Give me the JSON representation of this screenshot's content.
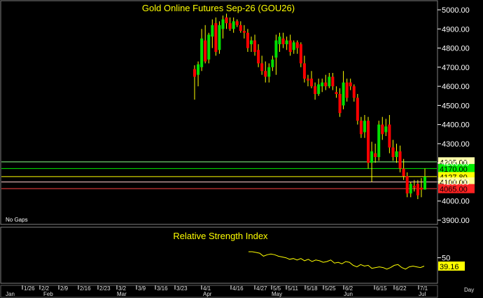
{
  "chart_data": [
    {
      "type": "candlestick",
      "title": "Gold Online Futures Sep-26 (GOU26)",
      "note": "No Gaps",
      "ylim": [
        3880,
        5030
      ],
      "yticks": [
        3900,
        4000,
        4100,
        4200,
        4300,
        4400,
        4500,
        4600,
        4700,
        4800,
        4900,
        5000
      ],
      "ytick_labels": [
        "3900.00",
        "4000.00",
        "4100.00",
        "4200.00",
        "4300.00",
        "4400.00",
        "4500.00",
        "4600.00",
        "4700.00",
        "4800.00",
        "4900.00",
        "5000.00"
      ],
      "colors": {
        "up": "#00e000",
        "down": "#ff0000",
        "wick": "#ffff00",
        "title": "#ffff00"
      },
      "candles": [
        {
          "o": 4690,
          "h": 4710,
          "l": 4530,
          "c": 4650
        },
        {
          "o": 4660,
          "h": 4730,
          "l": 4600,
          "c": 4715
        },
        {
          "o": 4700,
          "h": 4900,
          "l": 4680,
          "c": 4850
        },
        {
          "o": 4840,
          "h": 4920,
          "l": 4720,
          "c": 4730
        },
        {
          "o": 4740,
          "h": 4880,
          "l": 4720,
          "c": 4870
        },
        {
          "o": 4860,
          "h": 4950,
          "l": 4800,
          "c": 4920
        },
        {
          "o": 4930,
          "h": 4960,
          "l": 4760,
          "c": 4780
        },
        {
          "o": 4790,
          "h": 4940,
          "l": 4770,
          "c": 4920
        },
        {
          "o": 4900,
          "h": 4970,
          "l": 4850,
          "c": 4950
        },
        {
          "o": 4960,
          "h": 4980,
          "l": 4900,
          "c": 4930
        },
        {
          "o": 4930,
          "h": 4960,
          "l": 4890,
          "c": 4900
        },
        {
          "o": 4900,
          "h": 4960,
          "l": 4880,
          "c": 4940
        },
        {
          "o": 4940,
          "h": 4950,
          "l": 4910,
          "c": 4920
        },
        {
          "o": 4920,
          "h": 4940,
          "l": 4880,
          "c": 4890
        },
        {
          "o": 4890,
          "h": 4920,
          "l": 4850,
          "c": 4880
        },
        {
          "o": 4880,
          "h": 4900,
          "l": 4780,
          "c": 4800
        },
        {
          "o": 4820,
          "h": 4860,
          "l": 4780,
          "c": 4840
        },
        {
          "o": 4840,
          "h": 4870,
          "l": 4760,
          "c": 4780
        },
        {
          "o": 4790,
          "h": 4820,
          "l": 4700,
          "c": 4720
        },
        {
          "o": 4720,
          "h": 4760,
          "l": 4660,
          "c": 4680
        },
        {
          "o": 4680,
          "h": 4730,
          "l": 4620,
          "c": 4650
        },
        {
          "o": 4650,
          "h": 4720,
          "l": 4620,
          "c": 4700
        },
        {
          "o": 4700,
          "h": 4760,
          "l": 4680,
          "c": 4740
        },
        {
          "o": 4750,
          "h": 4870,
          "l": 4660,
          "c": 4840
        },
        {
          "o": 4820,
          "h": 4880,
          "l": 4780,
          "c": 4860
        },
        {
          "o": 4850,
          "h": 4880,
          "l": 4800,
          "c": 4820
        },
        {
          "o": 4820,
          "h": 4860,
          "l": 4790,
          "c": 4840
        },
        {
          "o": 4840,
          "h": 4870,
          "l": 4760,
          "c": 4780
        },
        {
          "o": 4790,
          "h": 4840,
          "l": 4770,
          "c": 4830
        },
        {
          "o": 4830,
          "h": 4840,
          "l": 4770,
          "c": 4800
        },
        {
          "o": 4820,
          "h": 4830,
          "l": 4700,
          "c": 4720
        },
        {
          "o": 4720,
          "h": 4760,
          "l": 4620,
          "c": 4640
        },
        {
          "o": 4640,
          "h": 4660,
          "l": 4600,
          "c": 4630
        },
        {
          "o": 4640,
          "h": 4680,
          "l": 4590,
          "c": 4600
        },
        {
          "o": 4600,
          "h": 4620,
          "l": 4530,
          "c": 4560
        },
        {
          "o": 4560,
          "h": 4640,
          "l": 4550,
          "c": 4610
        },
        {
          "o": 4600,
          "h": 4640,
          "l": 4570,
          "c": 4620
        },
        {
          "o": 4620,
          "h": 4660,
          "l": 4580,
          "c": 4600
        },
        {
          "o": 4600,
          "h": 4670,
          "l": 4590,
          "c": 4650
        },
        {
          "o": 4650,
          "h": 4670,
          "l": 4580,
          "c": 4600
        },
        {
          "o": 4570,
          "h": 4600,
          "l": 4540,
          "c": 4560
        },
        {
          "o": 4560,
          "h": 4590,
          "l": 4440,
          "c": 4460
        },
        {
          "o": 4500,
          "h": 4680,
          "l": 4480,
          "c": 4620
        },
        {
          "o": 4620,
          "h": 4640,
          "l": 4520,
          "c": 4540
        },
        {
          "o": 4620,
          "h": 4640,
          "l": 4580,
          "c": 4600
        },
        {
          "o": 4600,
          "h": 4610,
          "l": 4520,
          "c": 4540
        },
        {
          "o": 4540,
          "h": 4560,
          "l": 4400,
          "c": 4420
        },
        {
          "o": 4420,
          "h": 4440,
          "l": 4330,
          "c": 4350
        },
        {
          "o": 4360,
          "h": 4450,
          "l": 4330,
          "c": 4420
        },
        {
          "o": 4420,
          "h": 4440,
          "l": 4170,
          "c": 4200
        },
        {
          "o": 4200,
          "h": 4310,
          "l": 4100,
          "c": 4260
        },
        {
          "o": 4250,
          "h": 4300,
          "l": 4200,
          "c": 4230
        },
        {
          "o": 4230,
          "h": 4420,
          "l": 4210,
          "c": 4400
        },
        {
          "o": 4400,
          "h": 4440,
          "l": 4320,
          "c": 4350
        },
        {
          "o": 4360,
          "h": 4430,
          "l": 4340,
          "c": 4390
        },
        {
          "o": 4400,
          "h": 4450,
          "l": 4250,
          "c": 4280
        },
        {
          "o": 4280,
          "h": 4320,
          "l": 4210,
          "c": 4230
        },
        {
          "o": 4230,
          "h": 4300,
          "l": 4200,
          "c": 4260
        },
        {
          "o": 4260,
          "h": 4290,
          "l": 4150,
          "c": 4170
        },
        {
          "o": 4170,
          "h": 4220,
          "l": 4110,
          "c": 4130
        },
        {
          "o": 4130,
          "h": 4150,
          "l": 4020,
          "c": 4040
        },
        {
          "o": 4040,
          "h": 4100,
          "l": 4020,
          "c": 4090
        },
        {
          "o": 4080,
          "h": 4110,
          "l": 4050,
          "c": 4070
        },
        {
          "o": 4090,
          "h": 4110,
          "l": 4010,
          "c": 4030
        },
        {
          "o": 4070,
          "h": 4120,
          "l": 4020,
          "c": 4060
        },
        {
          "o": 4060,
          "h": 4170,
          "l": 4060,
          "c": 4128
        }
      ],
      "levels": [
        {
          "label": "4205.00",
          "value": 4205,
          "color": "#ffffaa",
          "line": "#88ff88",
          "bg": "#ffffaa",
          "fg": "#000000"
        },
        {
          "label": "4170.00",
          "value": 4170,
          "color": "#00ee00",
          "line": "#00ee00",
          "bg": "#00ee00",
          "fg": "#000000"
        },
        {
          "label": "4127.80",
          "value": 4127.8,
          "color": "#ffff00",
          "line": "#ffff00",
          "bg": "#ffff00",
          "fg": "#000000"
        },
        {
          "label": "4100.00",
          "value": 4100,
          "color": "#ffff88",
          "line": "#ffcccc",
          "bg": "#ffff88",
          "fg": "#000000"
        },
        {
          "label": "4065.00",
          "value": 4065,
          "color": "#ff2222",
          "line": "#ff4444",
          "bg": "#ff2222",
          "fg": "#000000"
        }
      ]
    },
    {
      "type": "line",
      "title": "Relative Strength Index",
      "ylim": [
        20,
        70
      ],
      "ytick_labels": [
        "50"
      ],
      "yticks": [
        50
      ],
      "last_value_label": "39.16",
      "series": [
        {
          "color": "#ffff00",
          "values": [
            58,
            58,
            57,
            56,
            52,
            54,
            55,
            54,
            52,
            51,
            50,
            48,
            49,
            47,
            49,
            46,
            48,
            45,
            47,
            46,
            44,
            45,
            47,
            43,
            44,
            42,
            45,
            44,
            40,
            38,
            41,
            39,
            40,
            36,
            37,
            38,
            37,
            35,
            37,
            40,
            41,
            37,
            35,
            38,
            39,
            38,
            37,
            39
          ]
        }
      ]
    }
  ],
  "x_axis": {
    "date_labels": [
      "1/26",
      "2/2",
      "2/9",
      "2/16",
      "2/23",
      "3/2",
      "3/9",
      "3/16",
      "3/23",
      "4/1",
      "4/16",
      "4/27",
      "5/5",
      "5/11",
      "5/18",
      "5/25",
      "6/2",
      "6/15",
      "6/22",
      "7/1"
    ],
    "month_labels": [
      "Jan",
      "Feb",
      "Mar",
      "Apr",
      "May",
      "Jun",
      "Jul"
    ],
    "day_label": "Day"
  }
}
